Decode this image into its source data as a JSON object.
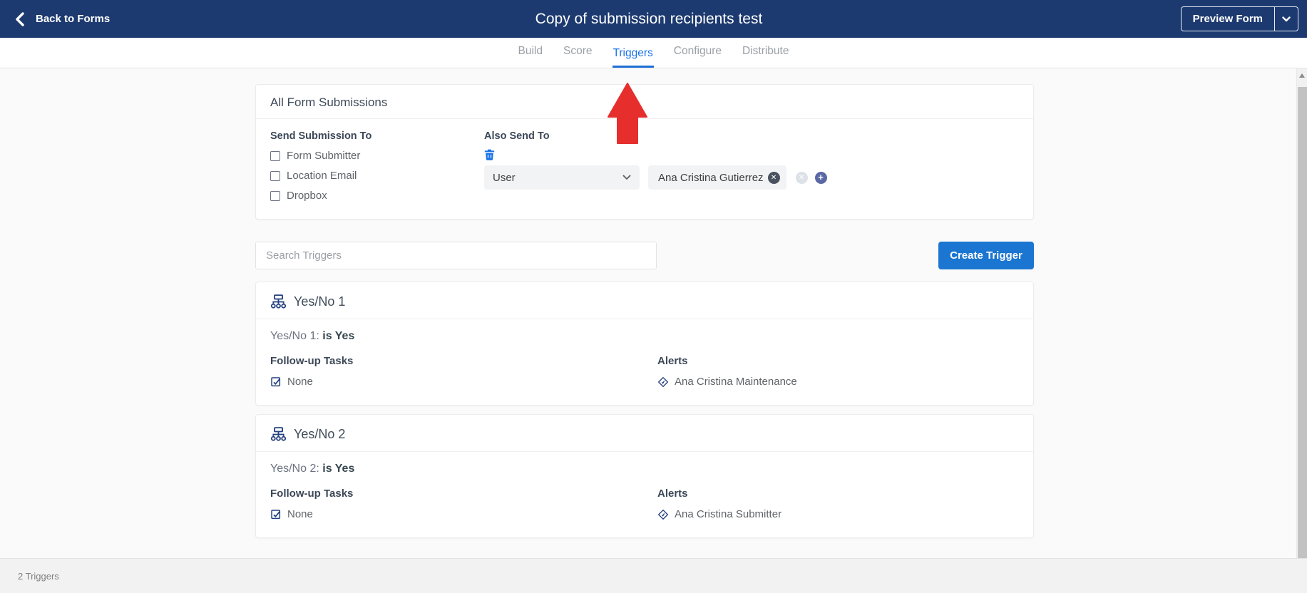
{
  "colors": {
    "header_navy": "#1c3a70",
    "accent_blue": "#1a73e8",
    "button_blue": "#1b76d1",
    "arrow_red": "#e62e2d",
    "icon_navy": "#24417e"
  },
  "header": {
    "back_label": "Back to Forms",
    "title": "Copy of submission recipients test",
    "preview_label": "Preview Form"
  },
  "tabs": [
    {
      "label": "Build",
      "active": false
    },
    {
      "label": "Score",
      "active": false
    },
    {
      "label": "Triggers",
      "active": true
    },
    {
      "label": "Configure",
      "active": false
    },
    {
      "label": "Distribute",
      "active": false
    }
  ],
  "submissions_card": {
    "title": "All Form Submissions",
    "send_to": {
      "heading": "Send Submission To",
      "options": [
        {
          "label": "Form Submitter",
          "checked": false
        },
        {
          "label": "Location Email",
          "checked": false
        },
        {
          "label": "Dropbox",
          "checked": false
        }
      ]
    },
    "also_send": {
      "heading": "Also Send To",
      "type_selected": "User",
      "recipient": "Ana Cristina Gutierrez"
    }
  },
  "icons": {
    "chip_remove_glyph": "✕",
    "remove_glyph": "✕",
    "add_glyph": "+"
  },
  "toolbar": {
    "search_placeholder": "Search Triggers",
    "create_label": "Create Trigger"
  },
  "triggers": [
    {
      "name": "Yes/No 1",
      "condition_field": "Yes/No 1:",
      "condition_value": "is Yes",
      "followup_heading": "Follow-up Tasks",
      "followup_value": "None",
      "alerts_heading": "Alerts",
      "alert_name": "Ana Cristina Maintenance"
    },
    {
      "name": "Yes/No 2",
      "condition_field": "Yes/No 2:",
      "condition_value": "is Yes",
      "followup_heading": "Follow-up Tasks",
      "followup_value": "None",
      "alerts_heading": "Alerts",
      "alert_name": "Ana Cristina Submitter"
    }
  ],
  "footer": {
    "trigger_count": "2 Triggers"
  }
}
